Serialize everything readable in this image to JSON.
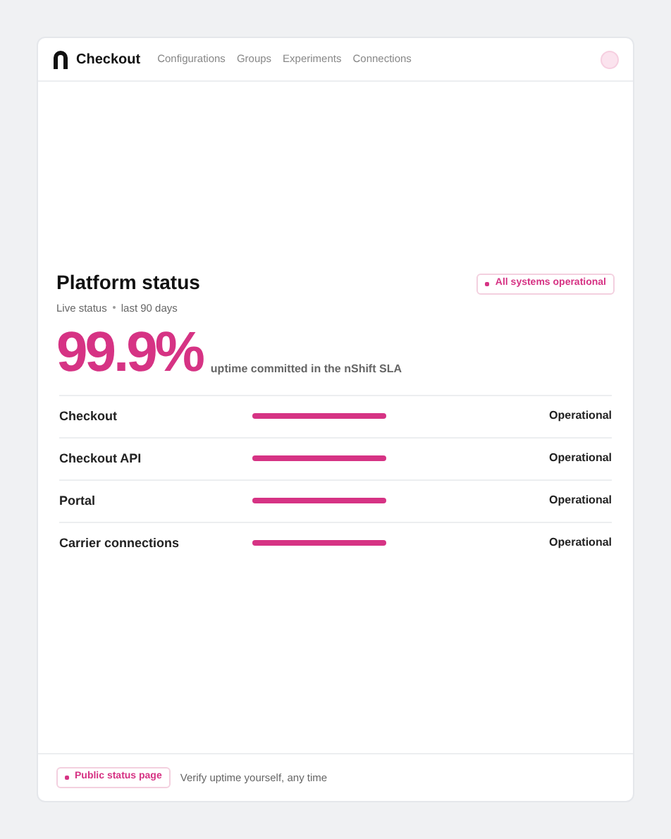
{
  "header": {
    "brand": "Checkout",
    "nav": [
      {
        "label": "Configurations"
      },
      {
        "label": "Groups"
      },
      {
        "label": "Experiments"
      },
      {
        "label": "Connections"
      }
    ]
  },
  "status": {
    "title": "Platform status",
    "subtitle": [
      "Live status",
      "last 90 days"
    ],
    "badge": "All systems operational",
    "uptime": "99.9%",
    "uptime_caption": "uptime committed in the nShift SLA",
    "services": [
      {
        "name": "Checkout",
        "state": "Operational"
      },
      {
        "name": "Checkout API",
        "state": "Operational"
      },
      {
        "name": "Portal",
        "state": "Operational"
      },
      {
        "name": "Carrier connections",
        "state": "Operational"
      }
    ]
  },
  "footer": {
    "link": "Public status page",
    "note": "Verify uptime yourself, any time"
  }
}
